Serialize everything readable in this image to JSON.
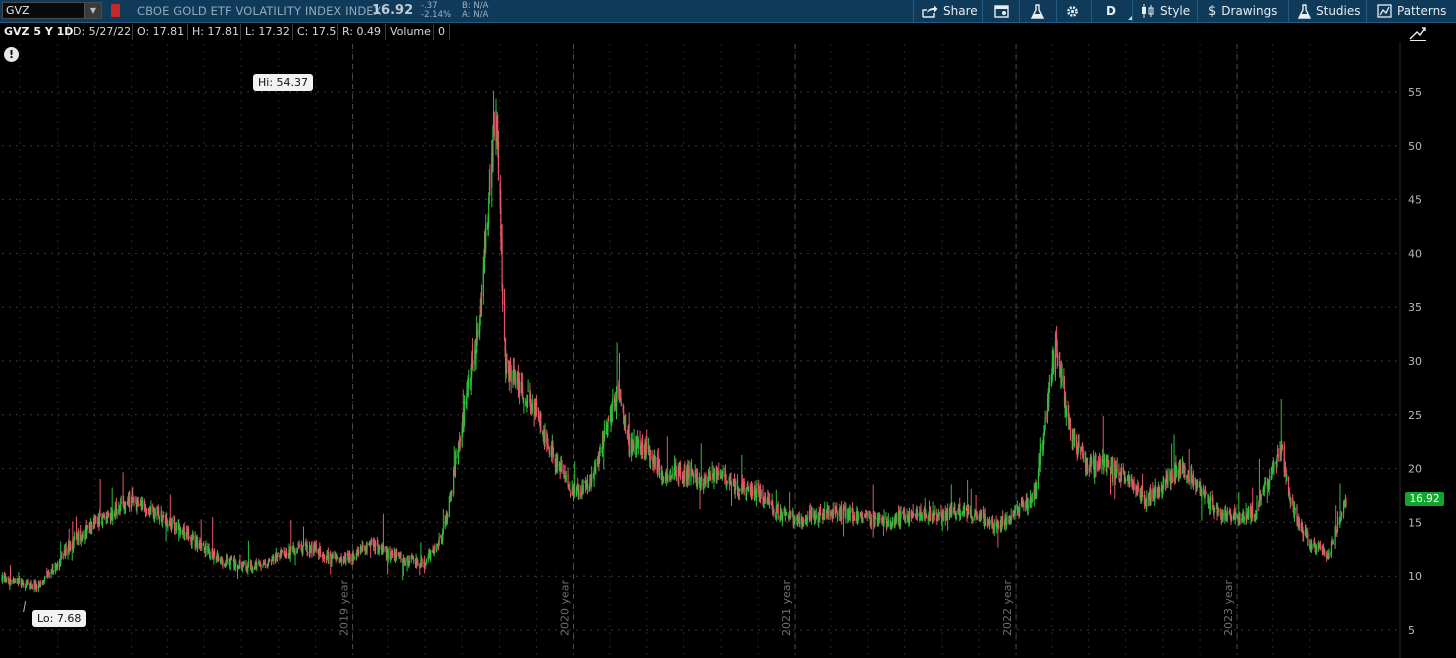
{
  "toolbar": {
    "symbol": "GVZ",
    "index_name": "CBOE GOLD ETF VOLATILITY INDEX INDEX",
    "last_price": "16.92",
    "change_abs": "-.37",
    "change_pct": "-2.14%",
    "bid": "B: N/A",
    "ask": "A: N/A",
    "buttons": {
      "share": "Share",
      "period": "D",
      "style": "Style",
      "drawings": "Drawings",
      "studies": "Studies",
      "patterns": "Patterns"
    },
    "icons": [
      "share-icon",
      "calendar-icon",
      "flask-icon",
      "gear-icon",
      "candles-icon",
      "dollar-icon",
      "flask-icon",
      "patterns-icon"
    ]
  },
  "infobar": {
    "title": "GVZ 5 Y 1D",
    "date": "D: 5/27/22",
    "open": "O: 17.81",
    "high": "H: 17.81",
    "low": "L: 17.32",
    "close": "C: 17.5",
    "range": "R: 0.49",
    "volume_label": "Volume",
    "volume_value": "0"
  },
  "annotations": {
    "alert": "!",
    "hi_label": "Hi: 54.37",
    "lo_label": "Lo: 7.68",
    "price_tag": "16.92"
  },
  "colors": {
    "up": "#2fbf3a",
    "down": "#e5566a",
    "background": "#000000",
    "toolbar": "#0f3a5a",
    "price_tag": "#11a62c"
  },
  "chart_data": {
    "type": "candlestick",
    "title": "GVZ 5 Y 1D",
    "xlabel": "",
    "ylabel": "",
    "ylim": [
      3,
      59
    ],
    "y_ticks": [
      5,
      10,
      15,
      20,
      25,
      30,
      35,
      40,
      45,
      50,
      55
    ],
    "x_ticks": [
      "2019 year",
      "2020 year",
      "2021 year",
      "2022 year",
      "2023 year"
    ],
    "x_range": [
      "2017-06-01",
      "2023-06-30"
    ],
    "grid": true,
    "last_value": 16.92,
    "high": 54.37,
    "high_date": "2019-08-26",
    "low": 7.68,
    "low_date": "2017-07-10",
    "series": [
      {
        "x": [
          "2017-06-01",
          "2017-07-01",
          "2017-08-01",
          "2017-09-01",
          "2017-10-01",
          "2017-11-01",
          "2017-12-01",
          "2018-01-01",
          "2018-02-01",
          "2018-03-01",
          "2018-04-01",
          "2018-05-01",
          "2018-06-01",
          "2018-07-01",
          "2018-08-01",
          "2018-09-01",
          "2018-10-01",
          "2018-11-01",
          "2018-12-01",
          "2019-01-01",
          "2019-02-01",
          "2019-03-01",
          "2019-04-01",
          "2019-05-01",
          "2019-06-01",
          "2019-07-01",
          "2019-08-01",
          "2019-08-26",
          "2019-09-10",
          "2019-10-01",
          "2019-11-01",
          "2019-12-01",
          "2020-01-01",
          "2020-02-01",
          "2020-03-15",
          "2020-04-01",
          "2020-05-01",
          "2020-06-01",
          "2020-07-01",
          "2020-08-01",
          "2020-09-01",
          "2020-10-01",
          "2020-11-01",
          "2020-12-01",
          "2021-01-01",
          "2021-02-01",
          "2021-03-01",
          "2021-04-01",
          "2021-05-01",
          "2021-06-01",
          "2021-07-01",
          "2021-08-01",
          "2021-09-01",
          "2021-10-01",
          "2021-11-01",
          "2021-12-01",
          "2022-01-01",
          "2022-02-01",
          "2022-03-08",
          "2022-04-01",
          "2022-05-01",
          "2022-06-01",
          "2022-07-01",
          "2022-08-01",
          "2022-09-01",
          "2022-10-01",
          "2022-11-01",
          "2022-12-01",
          "2023-01-01",
          "2023-02-01",
          "2023-03-15",
          "2023-04-01",
          "2023-05-01",
          "2023-06-01",
          "2023-06-30"
        ],
        "close": [
          9.8,
          9.4,
          9.0,
          11.2,
          13.5,
          15.0,
          15.8,
          17.0,
          16.0,
          15.2,
          14.0,
          12.5,
          11.5,
          11.0,
          10.8,
          12.0,
          12.5,
          12.5,
          11.5,
          11.8,
          13.0,
          12.0,
          11.5,
          11.2,
          14.0,
          24.0,
          35.0,
          54.37,
          30.0,
          28.0,
          25.0,
          21.0,
          17.5,
          19.0,
          27.5,
          22.0,
          22.0,
          19.0,
          19.5,
          19.0,
          19.5,
          18.0,
          18.0,
          16.0,
          15.2,
          15.5,
          16.0,
          15.8,
          15.5,
          15.0,
          15.5,
          15.8,
          15.5,
          16.0,
          15.5,
          14.8,
          16.0,
          17.5,
          31.5,
          23.0,
          20.0,
          20.5,
          19.0,
          17.0,
          18.5,
          20.2,
          18.0,
          15.8,
          15.5,
          16.0,
          22.0,
          16.5,
          13.0,
          12.0,
          16.92
        ]
      }
    ]
  }
}
